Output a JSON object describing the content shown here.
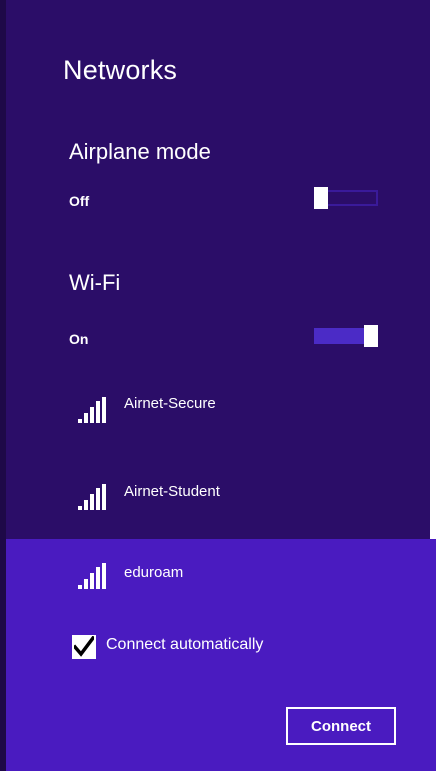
{
  "panel": {
    "title": "Networks"
  },
  "airplane_mode": {
    "label": "Airplane mode",
    "state_text": "Off",
    "on": false
  },
  "wifi": {
    "label": "Wi-Fi",
    "state_text": "On",
    "on": true
  },
  "networks": [
    {
      "name": "Airnet-Secure",
      "icon": "wifi-signal-icon"
    },
    {
      "name": "Airnet-Student",
      "icon": "wifi-signal-icon"
    },
    {
      "name": "eduroam",
      "icon": "wifi-signal-icon",
      "selected": true
    }
  ],
  "selected_network": {
    "connect_automatically_label": "Connect automatically",
    "connect_automatically": true,
    "connect_button_label": "Connect"
  },
  "colors": {
    "panel_bg": "#2b0d68",
    "selected_bg": "#4a1bc0",
    "toggle_on": "#4b2bc6"
  }
}
